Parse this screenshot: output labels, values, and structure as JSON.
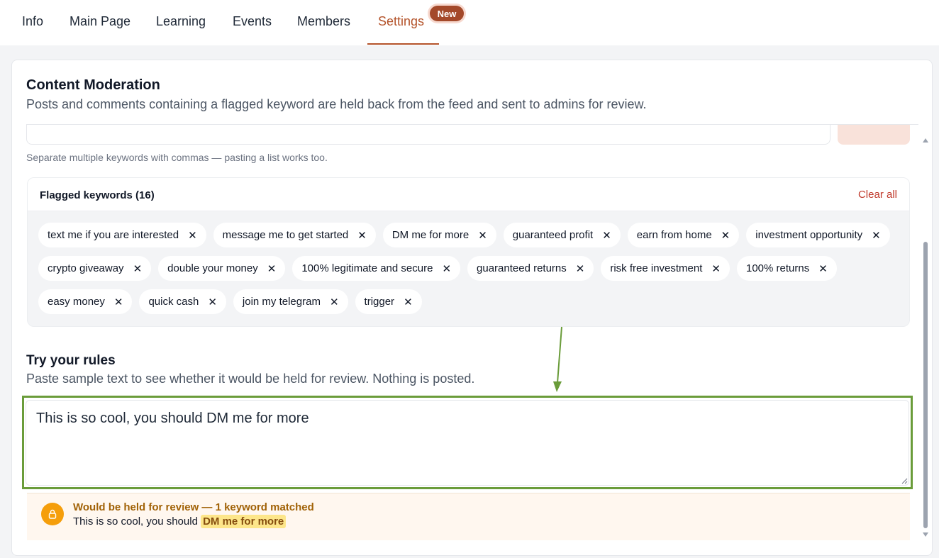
{
  "nav": {
    "tabs": [
      {
        "label": "Info"
      },
      {
        "label": "Main Page"
      },
      {
        "label": "Learning"
      },
      {
        "label": "Events"
      },
      {
        "label": "Members"
      },
      {
        "label": "Settings",
        "active": true
      }
    ],
    "badge": "New",
    "accent": "#b4532a"
  },
  "moderation": {
    "title": "Content Moderation",
    "description": "Posts and comments containing a flagged keyword are held back from the feed and sent to admins for review.",
    "help": "Separate multiple keywords with commas — pasting a list works too."
  },
  "keywords": {
    "title": "Flagged keywords (16)",
    "clear_label": "Clear all",
    "remove_glyph": "✕",
    "items": [
      "text me if you are interested",
      "message me to get started",
      "DM me for more",
      "guaranteed profit",
      "earn from home",
      "investment opportunity",
      "crypto giveaway",
      "double your money",
      "100% legitimate and secure",
      "guaranteed returns",
      "risk free investment",
      "100% returns",
      "easy money",
      "quick cash",
      "join my telegram",
      "trigger"
    ]
  },
  "tester": {
    "title": "Try your rules",
    "description": "Paste sample text to see whether it would be held for review. Nothing is posted.",
    "value": "This is so cool, you should DM me for more"
  },
  "result": {
    "title": "Would be held for review — 1 keyword matched",
    "text_before": "This is so cool, you should ",
    "match": "DM me for more",
    "icon": "lock-icon",
    "color": "#f59e0b"
  }
}
